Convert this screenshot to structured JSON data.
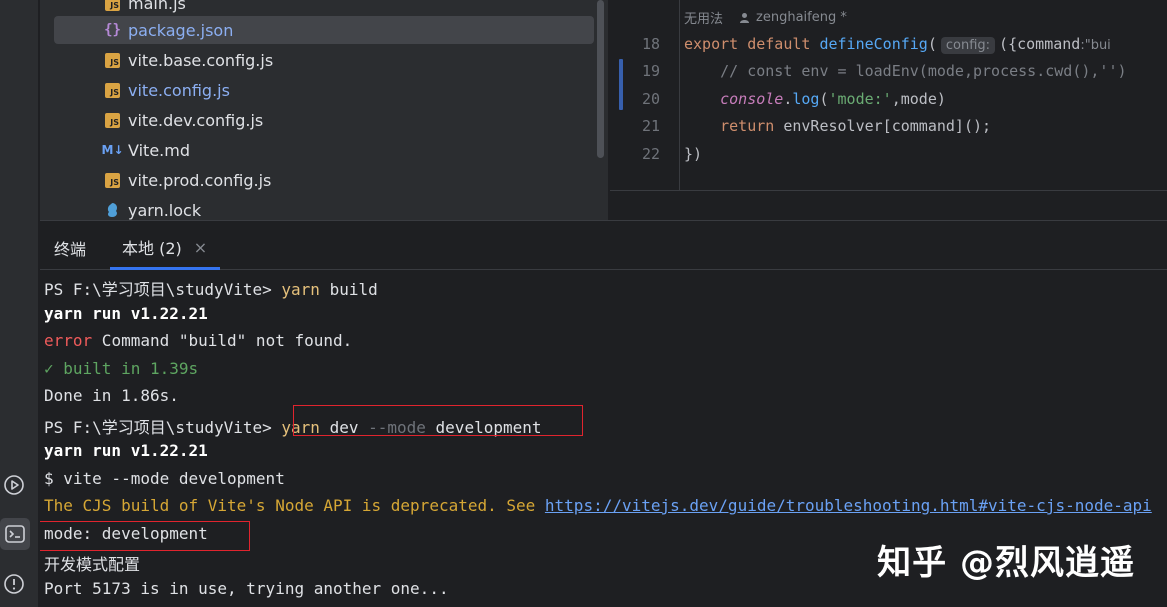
{
  "left_strip": {
    "icons": [
      "run-icon",
      "terminal-icon",
      "problems-icon"
    ]
  },
  "project_tree": {
    "items": [
      {
        "label": "main.js",
        "icon": "js-icon",
        "selected": false,
        "color": "normal"
      },
      {
        "label": "package.json",
        "icon": "json-icon",
        "selected": true,
        "color": "blue"
      },
      {
        "label": "vite.base.config.js",
        "icon": "js-icon",
        "selected": false,
        "color": "normal"
      },
      {
        "label": "vite.config.js",
        "icon": "js-icon",
        "selected": false,
        "color": "blue"
      },
      {
        "label": "vite.dev.config.js",
        "icon": "js-icon",
        "selected": false,
        "color": "normal"
      },
      {
        "label": "Vite.md",
        "icon": "markdown-icon",
        "selected": false,
        "color": "normal"
      },
      {
        "label": "vite.prod.config.js",
        "icon": "js-icon",
        "selected": false,
        "color": "normal"
      },
      {
        "label": "yarn.lock",
        "icon": "yarn-icon",
        "selected": false,
        "color": "normal"
      }
    ]
  },
  "editor": {
    "inlay_usages": "无用法",
    "inlay_author": "zenghaifeng *",
    "line_numbers": [
      "18",
      "19",
      "20",
      "21",
      "22"
    ],
    "lines": {
      "l18_kw1": "export",
      "l18_kw2": " default ",
      "l18_fn": "defineConfig",
      "l18_paren": "(",
      "l18_hint": "config:",
      "l18_rest": "({command",
      "l18_hint2": ":\"bui",
      "l19": "    // const env = loadEnv(mode,process.cwd(),'')",
      "l20_obj": "console",
      "l20_dot": ".",
      "l20_fn": "log",
      "l20_open": "(",
      "l20_str": "'mode:'",
      "l20_rest": ",mode)",
      "l21_kw": "return",
      "l21_rest": " envResolver[command]();",
      "l22": "})"
    }
  },
  "terminal": {
    "title": "终端",
    "tab_label": "本地 (2)",
    "tab_close": "×",
    "lines": {
      "l1_prompt": "PS F:\\学习项目\\studyVite> ",
      "l1_cmd": "yarn",
      "l1_arg": " build",
      "l2": "yarn run v1.22.21",
      "l3_err": "error",
      "l3_rest": " Command \"build\" not found.",
      "l4": "✓ built in 1.39s",
      "l5": "Done in 1.86s.",
      "l6_prompt": "PS F:\\学习项目\\studyVite> ",
      "l6_cmd": "yarn",
      "l6_arg1": " dev ",
      "l6_flag": "--mode",
      "l6_arg2": " development",
      "l7": "yarn run v1.22.21",
      "l8": "$ vite --mode development",
      "l9_text": "The CJS build of Vite's Node API is deprecated. See ",
      "l9_link": "https://vitejs.dev/guide/troubleshooting.html#vite-cjs-node-api",
      "l10": "mode: development",
      "l11": "开发模式配置",
      "l12": "Port 5173 is in use, trying another one..."
    }
  },
  "watermark": "知乎 @烈风逍遥",
  "colors": {
    "background": "#1e1f22",
    "panel": "#2b2d30",
    "accent": "#3574f0",
    "highlight_box": "#e0242e",
    "command": "#e5c07b",
    "error": "#ef5b5b",
    "success": "#5ea561",
    "warning": "#d6a735"
  }
}
